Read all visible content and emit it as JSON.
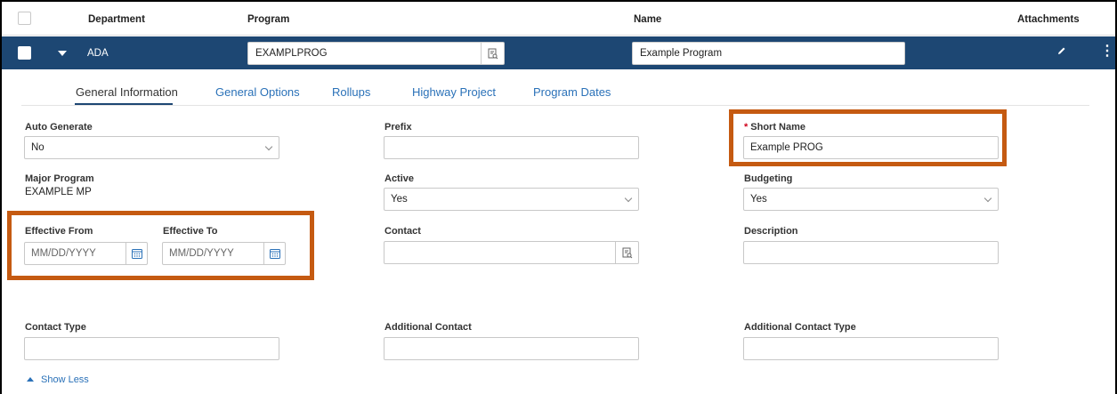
{
  "grid": {
    "headers": {
      "department": "Department",
      "program": "Program",
      "name": "Name",
      "attachments": "Attachments"
    },
    "record": {
      "department": "ADA",
      "program": "EXAMPLPROG",
      "name": "Example Program"
    }
  },
  "tabs": [
    {
      "label": "General Information",
      "active": true
    },
    {
      "label": "General Options",
      "active": false
    },
    {
      "label": "Rollups",
      "active": false
    },
    {
      "label": "Highway Project",
      "active": false
    },
    {
      "label": "Program Dates",
      "active": false
    }
  ],
  "form": {
    "auto_generate": {
      "label": "Auto Generate",
      "value": "No"
    },
    "prefix": {
      "label": "Prefix",
      "value": ""
    },
    "short_name": {
      "label": "Short Name",
      "required_mark": "*",
      "value": "Example PROG"
    },
    "major_program": {
      "label": "Major Program",
      "value": "EXAMPLE MP"
    },
    "active": {
      "label": "Active",
      "value": "Yes"
    },
    "budgeting": {
      "label": "Budgeting",
      "value": "Yes"
    },
    "effective_from": {
      "label": "Effective From",
      "placeholder": "MM/DD/YYYY"
    },
    "effective_to": {
      "label": "Effective To",
      "placeholder": "MM/DD/YYYY"
    },
    "contact": {
      "label": "Contact",
      "value": ""
    },
    "description": {
      "label": "Description",
      "value": ""
    },
    "contact_type": {
      "label": "Contact Type",
      "value": ""
    },
    "additional_contact": {
      "label": "Additional Contact",
      "value": ""
    },
    "additional_contact_type": {
      "label": "Additional Contact Type",
      "value": ""
    }
  },
  "show_less": "Show Less",
  "colors": {
    "header_bar": "#1d4773",
    "link": "#2a71b8",
    "highlight": "#c55a11",
    "required": "#d0021b"
  },
  "icons": {
    "lookup": "lookup-icon",
    "calendar": "calendar-icon",
    "pencil": "pencil-icon",
    "kebab": "kebab-menu-icon",
    "caret": "caret-down-icon"
  }
}
